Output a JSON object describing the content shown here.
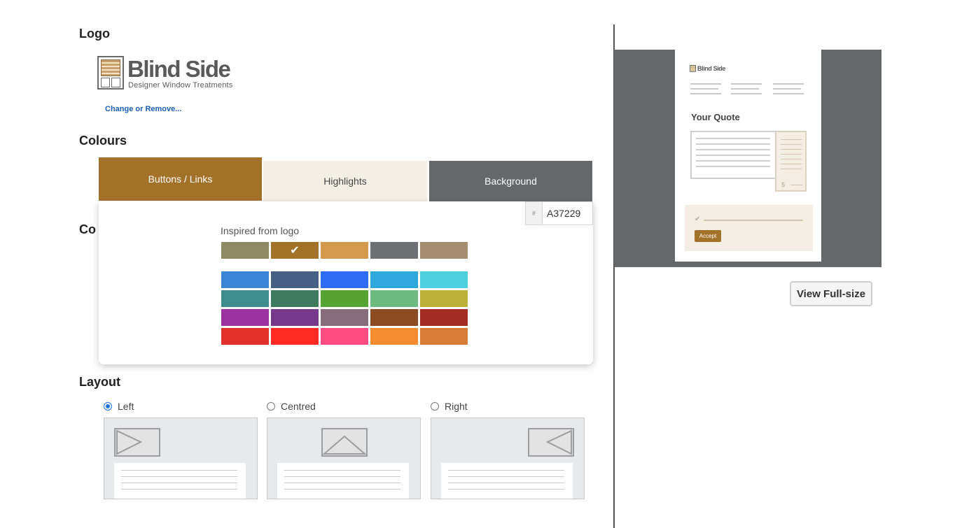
{
  "sections": {
    "logo_title": "Logo",
    "colours_title": "Colours",
    "hidden_title": "Co",
    "layout_title": "Layout"
  },
  "logo": {
    "name": "Blind Side",
    "tagline": "Designer Window Treatments",
    "change_link": "Change or Remove..."
  },
  "colour_tabs": [
    {
      "label": "Buttons / Links",
      "color": "#a37229",
      "active": true
    },
    {
      "label": "Highlights",
      "color": "#f4efe4",
      "active": false
    },
    {
      "label": "Background",
      "color": "#666769",
      "active": false
    }
  ],
  "picker": {
    "hash_label": "#",
    "hex_value": "A37229",
    "inspired_label": "Inspired from logo",
    "logo_swatches": [
      "#8e8a63",
      "#a37229",
      "#d19a4c",
      "#6f7073",
      "#a68d71"
    ],
    "selected_logo_swatch": 1,
    "check_glyph": "✔",
    "palette": [
      [
        "#3a86d4",
        "#455f85",
        "#2f6df5",
        "#2fa9db",
        "#4fd0df"
      ],
      [
        "#3d8c8e",
        "#3d7a5e",
        "#57a332",
        "#6ebb82",
        "#bcb23a"
      ],
      [
        "#9c31a2",
        "#77398c",
        "#856d7c",
        "#8a4c20",
        "#a32c24"
      ],
      [
        "#e0322b",
        "#fe2a23",
        "#ff4d83",
        "#f48d30",
        "#d87d37"
      ]
    ]
  },
  "layout_options": [
    {
      "label": "Left",
      "selected": true
    },
    {
      "label": "Centred",
      "selected": false
    },
    {
      "label": "Right",
      "selected": false
    }
  ],
  "preview": {
    "doc_logo": "Blind Side",
    "doc_title": "Your Quote",
    "dollar": "$",
    "tick": "✔",
    "accept_label": "Accept",
    "view_button": "View Full-size"
  }
}
